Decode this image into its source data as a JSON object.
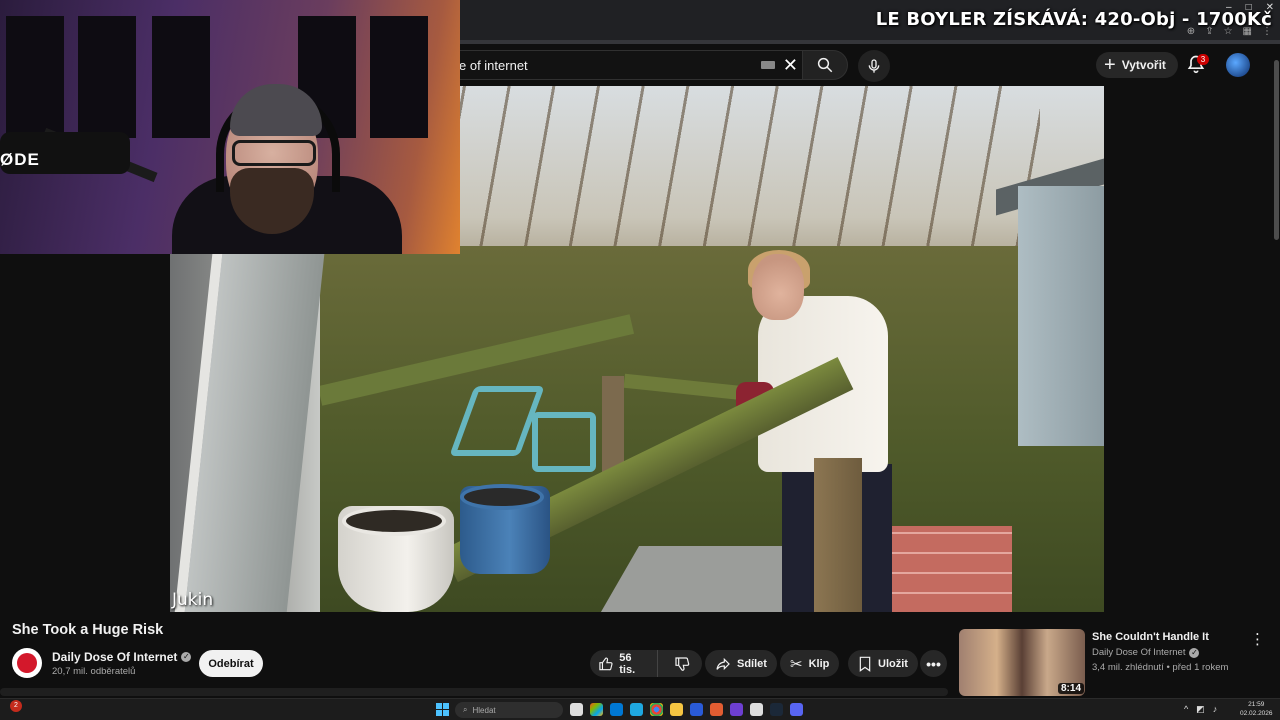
{
  "overlay": {
    "text": "LE BOYLER ZÍSKÁVÁ: 420-Obj - 1700Kč"
  },
  "header": {
    "search_value": "e of internet",
    "create_label": "Vytvořit",
    "notification_count": "3"
  },
  "video": {
    "watermark": "Jukin"
  },
  "webcam": {
    "mic_brand": "ØDE"
  },
  "meta": {
    "title": "She Took a Huge Risk",
    "channel": "Daily Dose Of Internet",
    "subscribers": "20,7 mil. odběratelů",
    "subscribe_label": "Odebírat",
    "likes": "56 tis.",
    "share_label": "Sdílet",
    "clip_label": "Klip",
    "save_label": "Uložit"
  },
  "recommendation": {
    "title": "She Couldn't Handle It",
    "channel": "Daily Dose Of Internet",
    "meta": "3,4 mil. zhlédnutí • před 1 rokem",
    "duration": "8:14"
  },
  "taskbar": {
    "search_placeholder": "Hledat",
    "time": "21:59",
    "date": "02.02.2026",
    "left_badge": "2"
  },
  "colors": {
    "background": "#0f0f0f",
    "accent_red": "#cc0000",
    "windows_blue": "#4cc2ff"
  }
}
